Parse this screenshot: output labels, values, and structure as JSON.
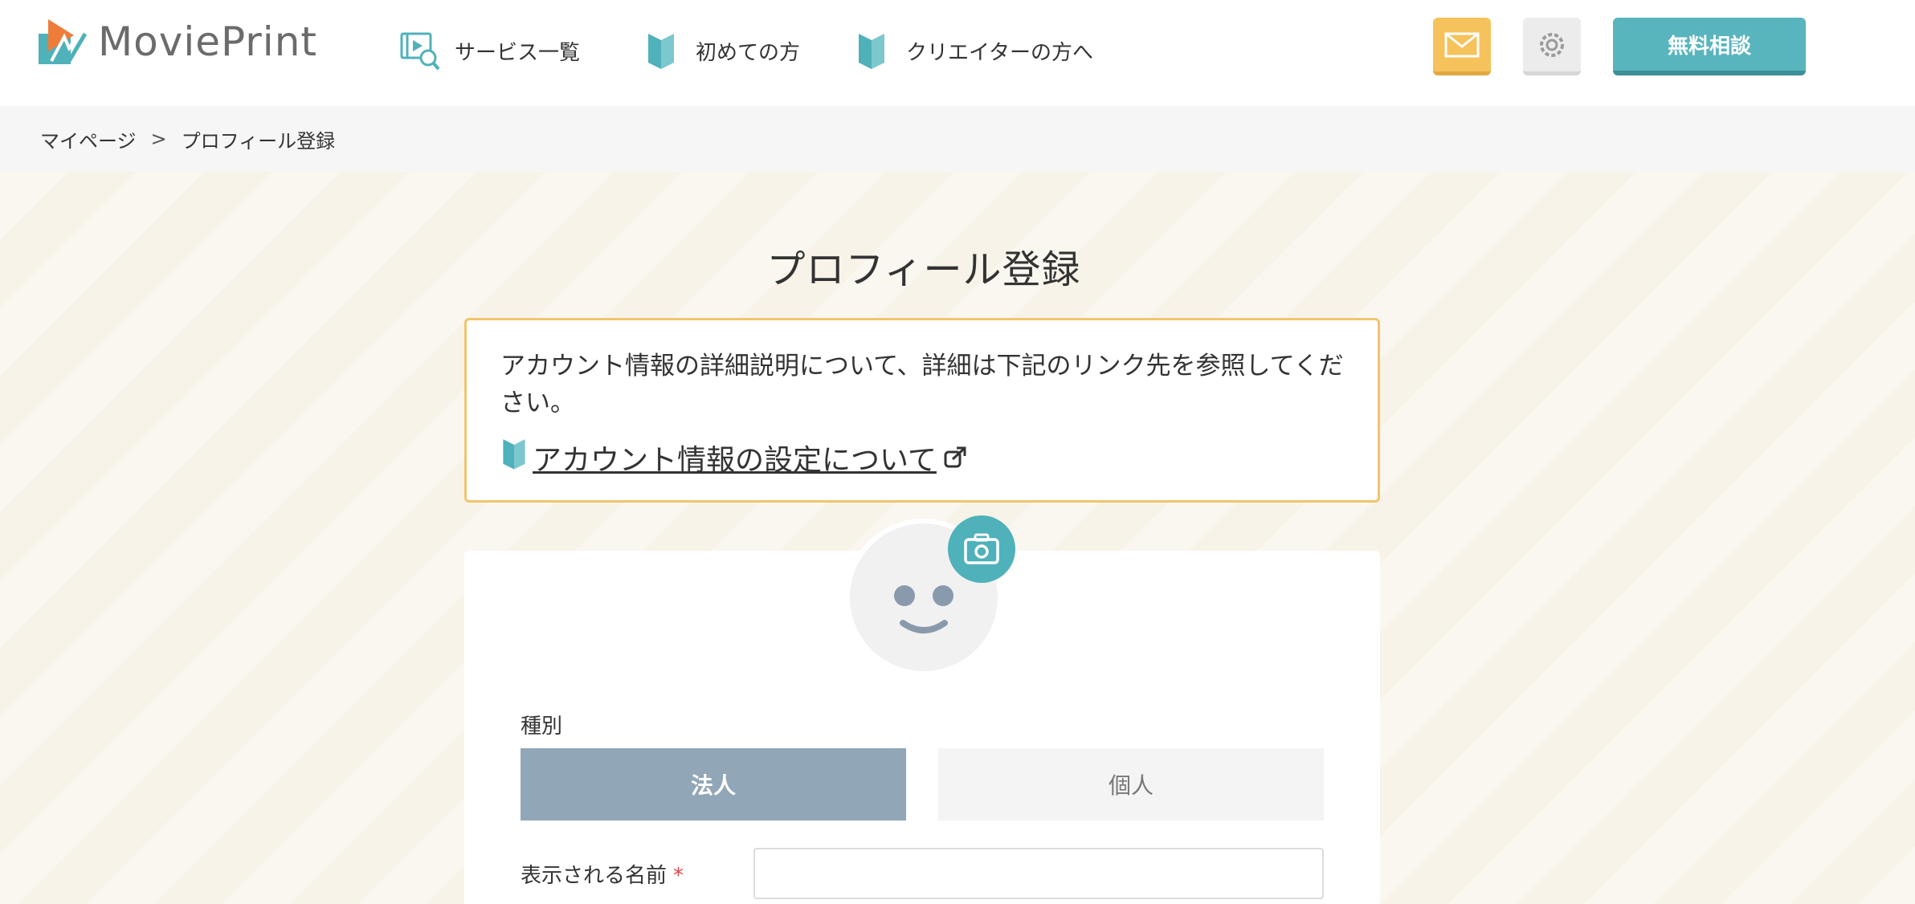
{
  "header": {
    "logo_text": "MoviePrint",
    "nav": [
      {
        "label": "サービス一覧",
        "icon": "video-search-icon"
      },
      {
        "label": "初めての方",
        "icon": "beginner-mark-icon"
      },
      {
        "label": "クリエイターの方へ",
        "icon": "beginner-mark-icon"
      }
    ],
    "mail_icon": "mail-icon",
    "settings_icon": "gear-icon",
    "consult_label": "無料相談"
  },
  "breadcrumb": {
    "items": [
      "マイページ",
      "プロフィール登録"
    ],
    "separator": ">"
  },
  "page": {
    "title": "プロフィール登録",
    "info_text": "アカウント情報の詳細説明について、詳細は下記のリンク先を参照してください。",
    "info_link": "アカウント情報の設定について"
  },
  "form": {
    "type_label": "種別",
    "type_options": [
      "法人",
      "個人"
    ],
    "selected_type": "法人",
    "name_label": "表示される名前",
    "required_mark": "*",
    "name_value": ""
  },
  "colors": {
    "accent": "#58b4bd",
    "mail": "#f5c25b",
    "info_border": "#f2c46d",
    "selected": "#91a7b8",
    "required": "#e0454a"
  }
}
